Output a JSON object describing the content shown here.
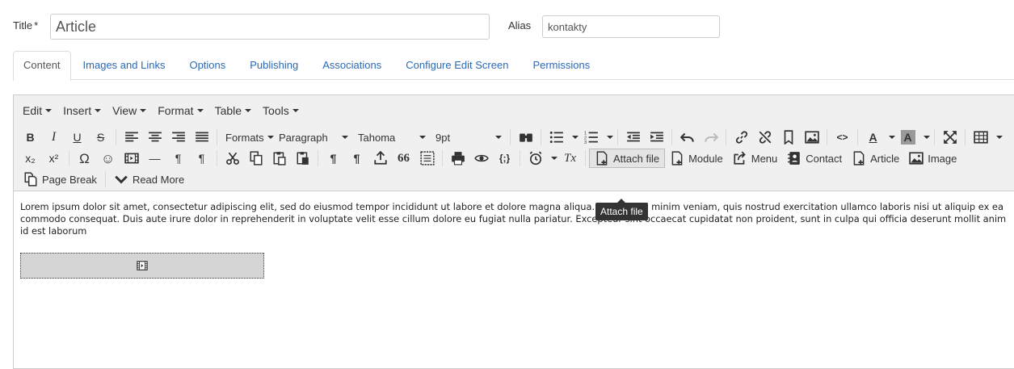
{
  "form": {
    "title_label": "Title",
    "required_mark": "*",
    "title_value": "Article",
    "alias_label": "Alias",
    "alias_value": "kontakty"
  },
  "tabs": [
    {
      "label": "Content",
      "active": true
    },
    {
      "label": "Images and Links"
    },
    {
      "label": "Options"
    },
    {
      "label": "Publishing"
    },
    {
      "label": "Associations"
    },
    {
      "label": "Configure Edit Screen"
    },
    {
      "label": "Permissions"
    }
  ],
  "menubar": {
    "edit": "Edit",
    "insert": "Insert",
    "view": "View",
    "format": "Format",
    "table": "Table",
    "tools": "Tools"
  },
  "toolbar": {
    "formats": "Formats",
    "paragraph": "Paragraph",
    "font_family": "Tahoma",
    "font_size": "9pt",
    "attach_file": "Attach file",
    "module": "Module",
    "menu": "Menu",
    "contact": "Contact",
    "article": "Article",
    "image": "Image",
    "page_break": "Page Break",
    "read_more": "Read More",
    "tooltip": "Attach file",
    "glyphs": {
      "bold": "B",
      "italic": "I",
      "underline": "U",
      "strike": "S",
      "subscript": "x₂",
      "superscript": "x²",
      "omega": "Ω",
      "smiley": "☺",
      "hr": "—",
      "ltr": "¶",
      "rtl": "¶",
      "pilcrow": "¶",
      "quote": "66",
      "code": "<>",
      "color_a": "A",
      "brackets": "{;}",
      "clear": "Tx"
    }
  },
  "content": {
    "paragraph": "Lorem ipsum dolor sit amet, consectetur adipiscing elit, sed do eiusmod tempor incididunt ut labore et dolore magna aliqua. Ut enim ad minim veniam, quis nostrud exercitation ullamco laboris nisi ut aliquip ex ea commodo consequat. Duis aute irure dolor in reprehenderit in voluptate velit esse cillum dolore eu fugiat nulla pariatur. Excepteur sint occaecat cupidatat non proident, sunt in culpa qui officia deserunt mollit anim id est laborum"
  },
  "colors": {
    "link": "#2a69b8",
    "toolbar_bg": "#f0f0f0",
    "tooltip_bg": "#333333"
  }
}
